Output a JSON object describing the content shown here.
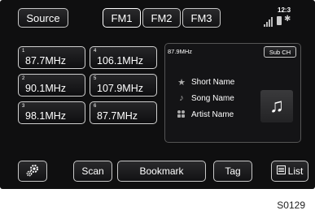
{
  "header": {
    "source_label": "Source",
    "tabs": [
      {
        "label": "FM1",
        "active": true
      },
      {
        "label": "FM2",
        "active": false
      },
      {
        "label": "FM3",
        "active": false
      }
    ],
    "status_text": "12:3",
    "status_icons": [
      "signal-bars-icon",
      "battery-icon",
      "bluetooth-icon"
    ]
  },
  "presets": [
    {
      "num": "1",
      "freq": "87.7MHz"
    },
    {
      "num": "2",
      "freq": "90.1MHz"
    },
    {
      "num": "3",
      "freq": "98.1MHz"
    },
    {
      "num": "4",
      "freq": "106.1MHz"
    },
    {
      "num": "5",
      "freq": "107.9MHz"
    },
    {
      "num": "6",
      "freq": "87.7MHz"
    }
  ],
  "info": {
    "current_freq": "87.9MHz",
    "subch_label": "Sub CH",
    "short_name": "Short Name",
    "song_name": "Song Name",
    "artist_name": "Artist Name"
  },
  "toolbar": {
    "settings_icon": "gear-icon",
    "scan_label": "Scan",
    "bookmark_label": "Bookmark",
    "tag_label": "Tag",
    "list_label": "List"
  },
  "figure_code": "S0129"
}
